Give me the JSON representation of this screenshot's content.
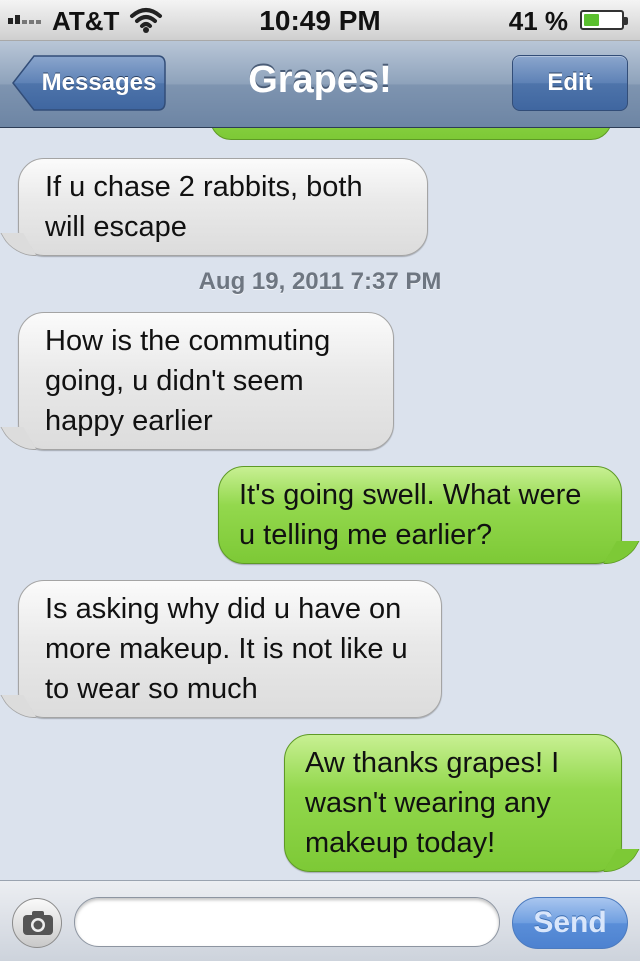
{
  "status_bar": {
    "carrier": "AT&T",
    "time": "10:49 PM",
    "battery_percent": "41 %",
    "battery_level": 0.41,
    "signal_bars": 2
  },
  "nav": {
    "back_label": "Messages",
    "title": "Grapes!",
    "edit_label": "Edit"
  },
  "conversation": {
    "messages": [
      {
        "direction": "received",
        "text": "If u chase 2 rabbits, both will escape"
      },
      {
        "direction": "timestamp",
        "text": "Aug 19, 2011 7:37 PM"
      },
      {
        "direction": "received",
        "text": "How is the commuting going, u didn't seem happy earlier"
      },
      {
        "direction": "sent",
        "text": "It's going swell. What were u telling me earlier?"
      },
      {
        "direction": "received",
        "text": "Is asking why did u have on more makeup. It is not like u to wear so much"
      },
      {
        "direction": "sent",
        "text": "Aw thanks grapes! I wasn't wearing any makeup today!"
      }
    ]
  },
  "compose": {
    "input_value": "",
    "placeholder": "",
    "send_label": "Send"
  },
  "colors": {
    "sent_bubble": "#7dc936",
    "received_bubble": "#dcdcdc",
    "nav_bar": "#7e94b0",
    "send_button": "#5a8ed8"
  },
  "icons": {
    "camera": "camera-icon",
    "wifi": "wifi-icon",
    "battery": "battery-icon"
  }
}
